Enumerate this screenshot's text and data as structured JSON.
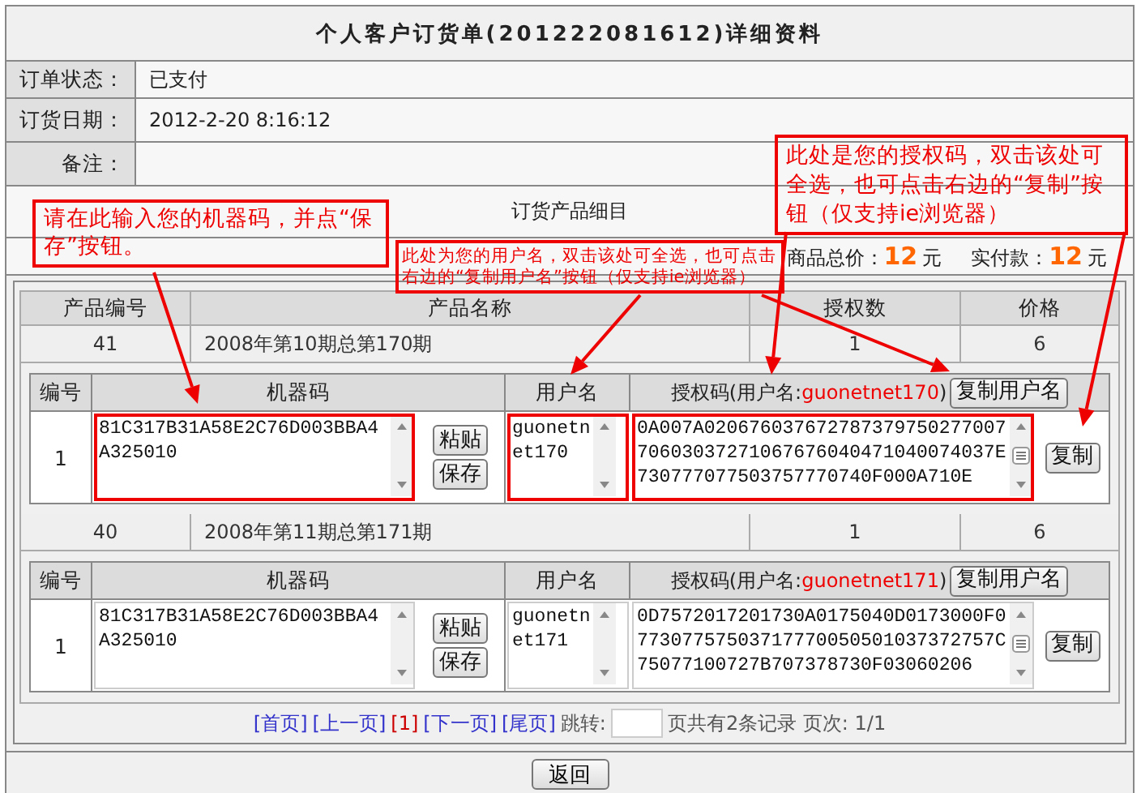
{
  "title": "个人客户订货单(201222081612)详细资料",
  "info": [
    {
      "label": "订单状态：",
      "value": "已支付"
    },
    {
      "label": "订货日期：",
      "value": "2012-2-20 8:16:12"
    },
    {
      "label": "备注："
    }
  ],
  "section_title": "订货产品细目",
  "totals": {
    "goods_label": "商品总价：",
    "goods_amount": "12",
    "goods_unit": "元",
    "paid_label": "实付款：",
    "paid_amount": "12",
    "paid_unit": "元"
  },
  "product_columns": [
    "产品编号",
    "产品名称",
    "授权数",
    "价格"
  ],
  "products": [
    {
      "id": "41",
      "name": "2008年第10期总第170期",
      "licenses": "1",
      "price": "6",
      "license": {
        "columns": [
          "编号",
          "机器码",
          "用户名"
        ],
        "no": "1",
        "machine_code": "81C317B31A58E2C76D003BBA4A325010",
        "paste_button": "粘贴",
        "save_button": "保存",
        "username": "guonetnet170",
        "auth_label": "授权码(用户名:",
        "auth_username": "guonetnet170",
        "auth_label_end": ")",
        "copy_username_button": "复制用户名",
        "auth_code": "0A007A02067603767278737975027700770603037271067676040471040074037E730777077503757770740F000A710E",
        "copy_button": "复制",
        "annotated": true
      }
    },
    {
      "id": "40",
      "name": "2008年第11期总第171期",
      "licenses": "1",
      "price": "6",
      "license": {
        "columns": [
          "编号",
          "机器码",
          "用户名"
        ],
        "no": "1",
        "machine_code": "81C317B31A58E2C76D003BBA4A325010",
        "paste_button": "粘贴",
        "save_button": "保存",
        "username": "guonetnet171",
        "auth_label": "授权码(用户名:",
        "auth_username": "guonetnet171",
        "auth_label_end": ")",
        "copy_username_button": "复制用户名",
        "auth_code": "0D7572017201730A0175040D0173000F077307757503717770050501037372757C75077100727B707378730F03060206",
        "copy_button": "复制",
        "annotated": false
      }
    }
  ],
  "pagination": {
    "links": [
      {
        "label": "[首页]",
        "selected": false
      },
      {
        "label": "[上一页]",
        "selected": false
      },
      {
        "label": "[1]",
        "selected": true
      },
      {
        "label": "[下一页]",
        "selected": false
      },
      {
        "label": "[尾页]",
        "selected": false
      }
    ],
    "jump_label": "跳转:",
    "summary": "页共有2条记录 页次: 1/1"
  },
  "back_button": "返回",
  "callouts": [
    {
      "kind": "machine",
      "text": "请在此输入您的机器码，并点“保存”按钮。"
    },
    {
      "kind": "username",
      "text": "此处为您的用户名，双击该处可全选，也可点击右边的“复制用户名”按钮（仅支持ie浏览器）"
    },
    {
      "kind": "auth",
      "text": "此处是您的授权码，双击该处可全选，也可点击右边的“复制”按钮（仅支持ie浏览器）"
    }
  ]
}
